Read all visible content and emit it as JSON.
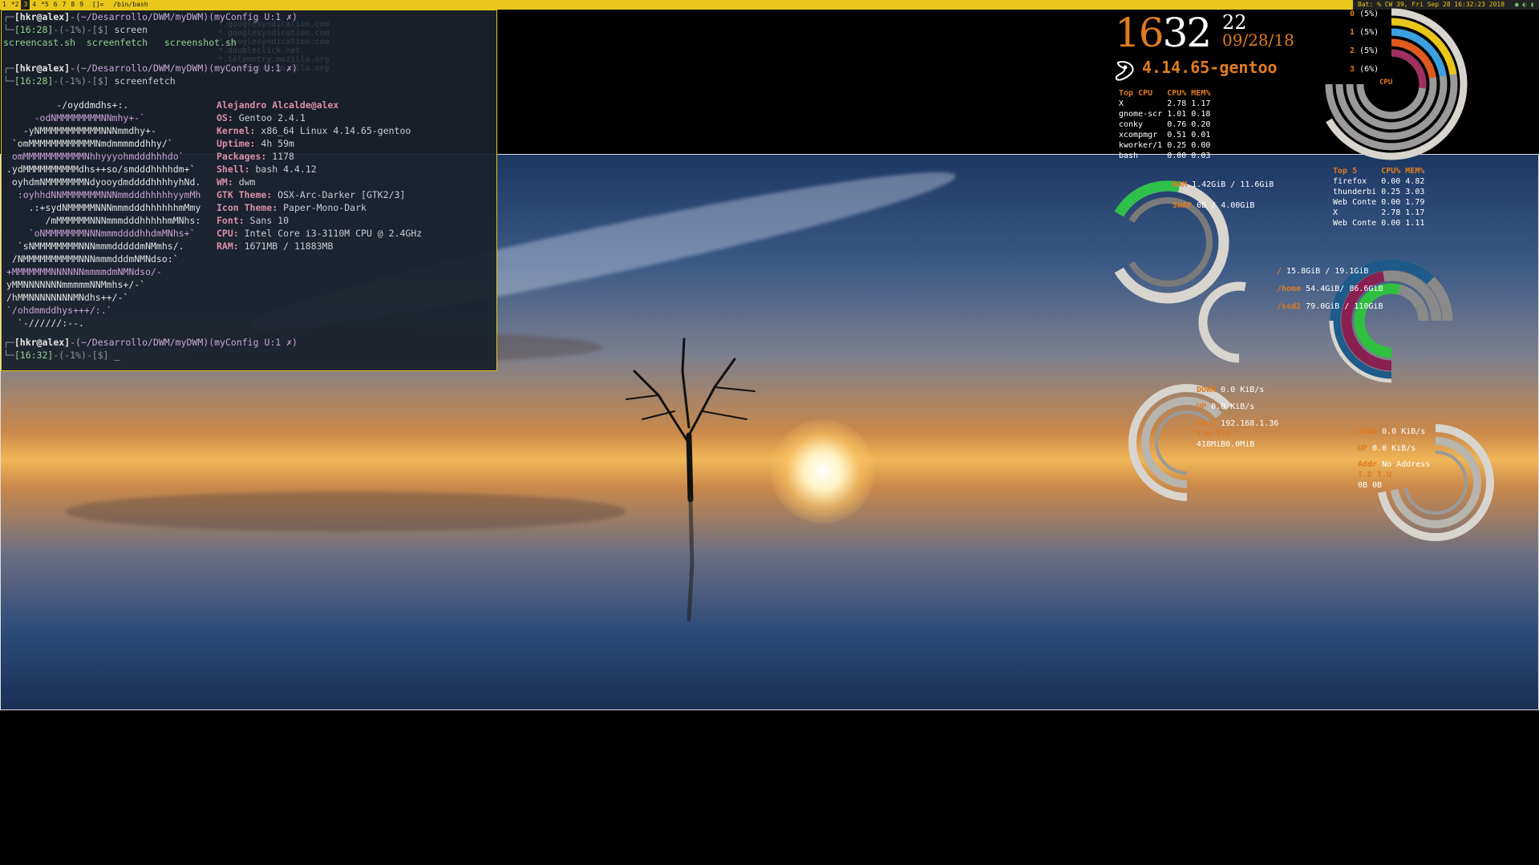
{
  "topbar": {
    "tags": [
      {
        "label": "1",
        "active": false
      },
      {
        "label": "*2",
        "active": false
      },
      {
        "label": "3",
        "active": true
      },
      {
        "label": "4",
        "active": false
      },
      {
        "label": "*5",
        "active": false
      },
      {
        "label": "6",
        "active": false
      },
      {
        "label": "7",
        "active": false
      },
      {
        "label": "8",
        "active": false
      },
      {
        "label": "9",
        "active": false
      }
    ],
    "layout": "[]=",
    "window_title": "/bin/bash",
    "status": "Bat: %   CW 39, Fri Sep 28 16:32:23 2018"
  },
  "terminal": {
    "prompt1_user": "[hkr@alex]",
    "prompt1_path": "-(~/Desarrollo/DWM/myDWM)",
    "prompt1_branch": "(myConfig U:1 ✗)",
    "prompt1_time": "[16:28]",
    "prompt1_mid": "-(-1%)-[$]",
    "cmd1": " screen",
    "files": [
      "screencast.sh",
      "screenfetch",
      "screenshot.sh"
    ],
    "prompt2_user": "[hkr@alex]",
    "prompt2_path": "-(~/Desarrollo/DWM/myDWM)",
    "prompt2_branch": "(myConfig U:1 ✗)",
    "prompt2_time": "[16:28]",
    "prompt2_mid": "-(-1%)-[$]",
    "cmd2": " screenfetch",
    "logo": [
      "         -/oyddmdhs+:.",
      "     -odNMMMMMMMMNNmhy+-`",
      "   -yNMMMMMMMMMMMNNNmmdhy+-",
      " `omMMMMMMMMMMMMNmdmmmmddhhy/`",
      " omMMMMMMMMMMMNhhyyyohmdddhhhdo`",
      ".ydMMMMMMMMMMdhs++so/smdddhhhhdm+`",
      " oyhdmNMMMMMMMNdyooydmddddhhhhyhNd.",
      "  :oyhhdNNMMMMMMMNNNmmdddhhhhhyymMh",
      "    .:+sydNMMMMMNNNmmmdddhhhhhhmMmy",
      "       /mMMMMMMNNNmmmdddhhhhhmMNhs:",
      "    `oNMMMMMMMNNNmmmddddhhdmMNhs+`",
      "  `sNMMMMMMMMNNNmmmdddddmNMmhs/.",
      " /NMMMMMMMMMMNNNmmmdddmNMNdso:`",
      "+MMMMMMMNNNNNNmmmmdmNMNdso/-",
      "yMMNNNNNNNmmmmmNNMmhs+/-`",
      "/hMMNNNNNNNNMNdhs++/-`",
      "`/ohdmmddhys+++/:.`",
      "  `-//////:--."
    ],
    "info": [
      {
        "key": "",
        "val": "Alejandro Alcalde@alex"
      },
      {
        "key": "OS:",
        "val": " Gentoo 2.4.1"
      },
      {
        "key": "Kernel:",
        "val": " x86_64 Linux 4.14.65-gentoo"
      },
      {
        "key": "Uptime:",
        "val": " 4h 59m"
      },
      {
        "key": "Packages:",
        "val": " 1178"
      },
      {
        "key": "Shell:",
        "val": " bash 4.4.12"
      },
      {
        "key": "WM:",
        "val": " dwm"
      },
      {
        "key": "GTK Theme:",
        "val": " OSX-Arc-Darker [GTK2/3]"
      },
      {
        "key": "Icon Theme:",
        "val": " Paper-Mono-Dark"
      },
      {
        "key": "Font:",
        "val": " Sans 10"
      },
      {
        "key": "CPU:",
        "val": " Intel Core i3-3110M CPU @ 2.4GHz"
      },
      {
        "key": "RAM:",
        "val": " 1671MB / 11883MB"
      }
    ],
    "prompt3_user": "[hkr@alex]",
    "prompt3_path": "-(~/Desarrollo/DWM/myDWM)",
    "prompt3_branch": "(myConfig U:1 ✗)",
    "prompt3_time": "[16:32]",
    "prompt3_mid": "-(-1%)-[$]",
    "cursor": " _"
  },
  "conky": {
    "clock": {
      "hour": "16",
      "minute": "32",
      "second": "22",
      "date": "09/28/18"
    },
    "kernel": "4.14.65-gentoo",
    "topcpu": {
      "headers": [
        "Top CPU",
        "CPU%",
        "MEM%"
      ],
      "rows": [
        [
          "X",
          "2.78",
          "1.17"
        ],
        [
          "gnome-scr",
          "1.01",
          "0.18"
        ],
        [
          "conky",
          "0.76",
          "0.20"
        ],
        [
          "xcompmgr",
          "0.51",
          "0.01"
        ],
        [
          "kworker/1",
          "0.25",
          "0.00"
        ],
        [
          "bash",
          "0.00",
          "0.03"
        ]
      ]
    },
    "top5": {
      "headers": [
        "Top 5",
        "CPU%",
        "MEM%"
      ],
      "rows": [
        [
          "firefox",
          "0.00",
          "4.82"
        ],
        [
          "thunderbi",
          "0.25",
          "3.03"
        ],
        [
          "Web Conte",
          "0.00",
          "1.79"
        ],
        [
          "X",
          "2.78",
          "1.17"
        ],
        [
          "Web Conte",
          "0.00",
          "1.11"
        ]
      ]
    },
    "cpus": [
      {
        "label": "0",
        "pct": "(5%)",
        "value": 5,
        "color": "#e8c61a"
      },
      {
        "label": "1",
        "pct": "(5%)",
        "value": 5,
        "color": "#3aa0e0"
      },
      {
        "label": "2",
        "pct": "(5%)",
        "value": 5,
        "color": "#e05a20"
      },
      {
        "label": "3",
        "pct": "(6%)",
        "value": 6,
        "color": "#a03060"
      }
    ],
    "cpu_label": "CPU",
    "mem": {
      "ram_label": "RAM",
      "ram": "1.42GiB / 11.6GiB",
      "ram_value": 12,
      "swap_label": "SWAP",
      "swap": "0B  / 4.00GiB",
      "swap_value": 0
    },
    "disks": [
      {
        "label": "/",
        "val": " 15.8GiB  / 19.1GiB",
        "value": 83,
        "color": "#1e5a8a"
      },
      {
        "label": "/home",
        "val": " 54.4GiB/ 86.6GiB",
        "value": 63,
        "color": "#8a2050"
      },
      {
        "label": "/ssd2",
        "val": " 79.0GiB / 110GiB",
        "value": 72,
        "color": "#30c040"
      }
    ],
    "net1": {
      "down_label": "DOWN",
      "down": "0.0 KiB/s",
      "up_label": "UP",
      "up": "0.0 KiB/s",
      "addr_label": "Addr",
      "addr": "192.168.1.36",
      "td_label": "T.D",
      "tu_label": "T.U",
      "td": "418MiB",
      "tu": "0.0MiB"
    },
    "net2": {
      "down_label": "DOWN",
      "down": "0.0 KiB/s",
      "up_label": "UP",
      "up": "0.0 KiB/s",
      "addr_label": "Addr",
      "addr": "No Address",
      "td_label": "T.D",
      "tu_label": "T.U",
      "td": "0B",
      "tu": "0B"
    }
  }
}
